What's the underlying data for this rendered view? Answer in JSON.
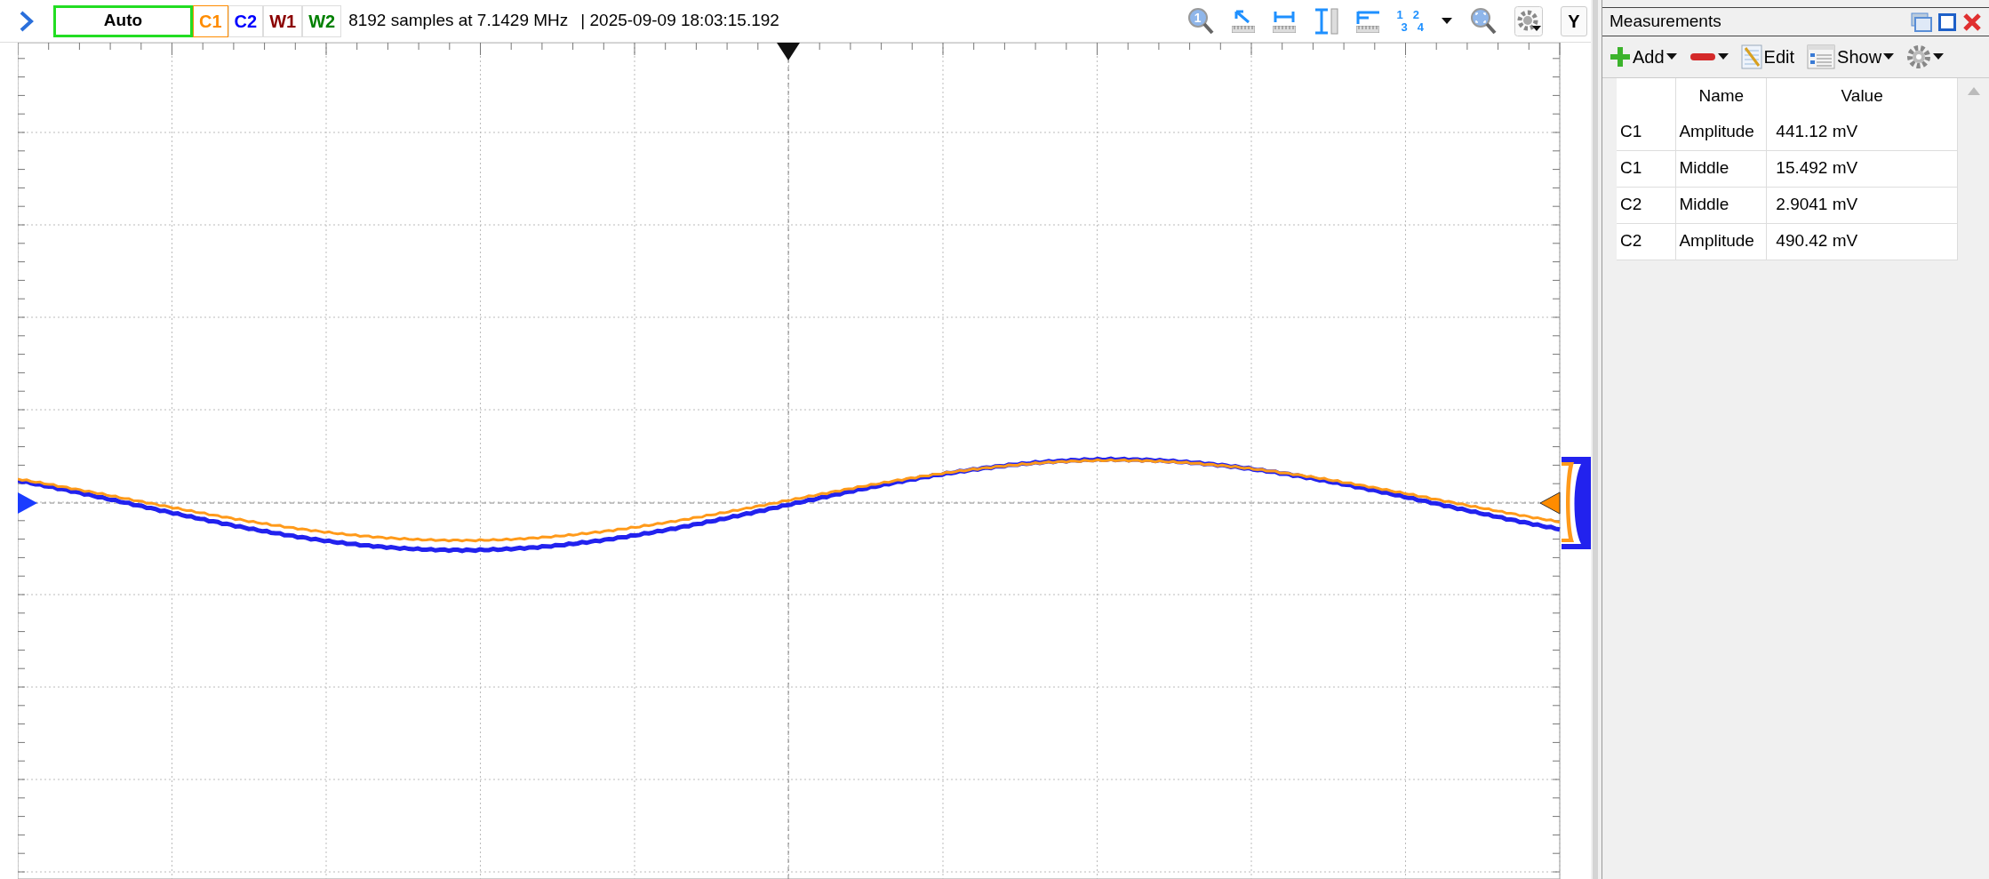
{
  "toolbar": {
    "trigger_mode": "Auto",
    "channels": [
      {
        "label": "C1",
        "color": "#ff8c00"
      },
      {
        "label": "C2",
        "color": "#0000ff"
      },
      {
        "label": "W1",
        "color": "#8b0000"
      },
      {
        "label": "W2",
        "color": "#008000"
      }
    ],
    "info": "8192 samples at 7.1429 MHz",
    "timestamp": "| 2025-09-09 18:03:15.192",
    "zoom_label": "1",
    "layout_digits": [
      "1",
      "2",
      "3",
      "4"
    ],
    "y_button": "Y"
  },
  "measurements": {
    "title": "Measurements",
    "actions": [
      {
        "kind": "add",
        "label": "Add"
      },
      {
        "kind": "remove"
      },
      {
        "kind": "edit",
        "label": "Edit"
      },
      {
        "kind": "show",
        "label": "Show"
      },
      {
        "kind": "settings"
      }
    ],
    "columns": [
      "Name",
      "Value"
    ],
    "rows": [
      {
        "channel": "C1",
        "name": "Amplitude",
        "value": "441.12 mV"
      },
      {
        "channel": "C1",
        "name": "Middle",
        "value": "15.492 mV"
      },
      {
        "channel": "C2",
        "name": "Middle",
        "value": "2.9041 mV"
      },
      {
        "channel": "C2",
        "name": "Amplitude",
        "value": "490.42 mV"
      }
    ]
  }
}
